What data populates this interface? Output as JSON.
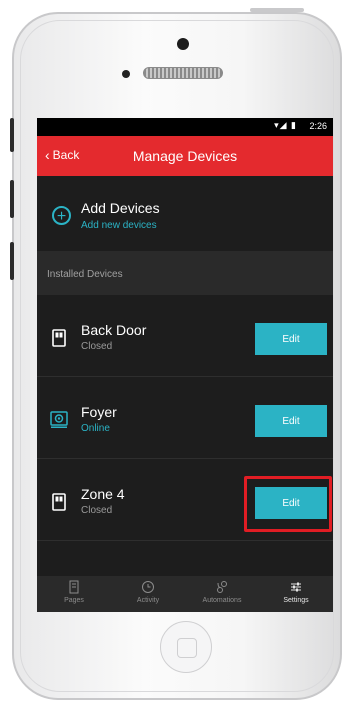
{
  "status_bar": {
    "time": "2:26",
    "icons": "▾◢ ▮"
  },
  "app_bar": {
    "back_label": "Back",
    "title": "Manage Devices"
  },
  "add_devices": {
    "title": "Add Devices",
    "subtitle": "Add new devices"
  },
  "section_header": "Installed Devices",
  "devices": [
    {
      "name": "Back Door",
      "status": "Closed",
      "icon": "door-sensor-icon",
      "edit_label": "Edit"
    },
    {
      "name": "Foyer",
      "status": "Online",
      "icon": "camera-device-icon",
      "edit_label": "Edit"
    },
    {
      "name": "Zone 4",
      "status": "Closed",
      "icon": "door-sensor-icon",
      "edit_label": "Edit"
    }
  ],
  "tabs": [
    {
      "label": "Pages",
      "icon": "pages-icon"
    },
    {
      "label": "Activity",
      "icon": "clock-icon"
    },
    {
      "label": "Automations",
      "icon": "automations-icon"
    },
    {
      "label": "Settings",
      "icon": "sliders-icon",
      "active": true
    }
  ],
  "colors": {
    "accent": "#2bb3c5",
    "brand_red": "#e42a2e",
    "background": "#1d1d1d",
    "highlight": "#e11d24"
  }
}
